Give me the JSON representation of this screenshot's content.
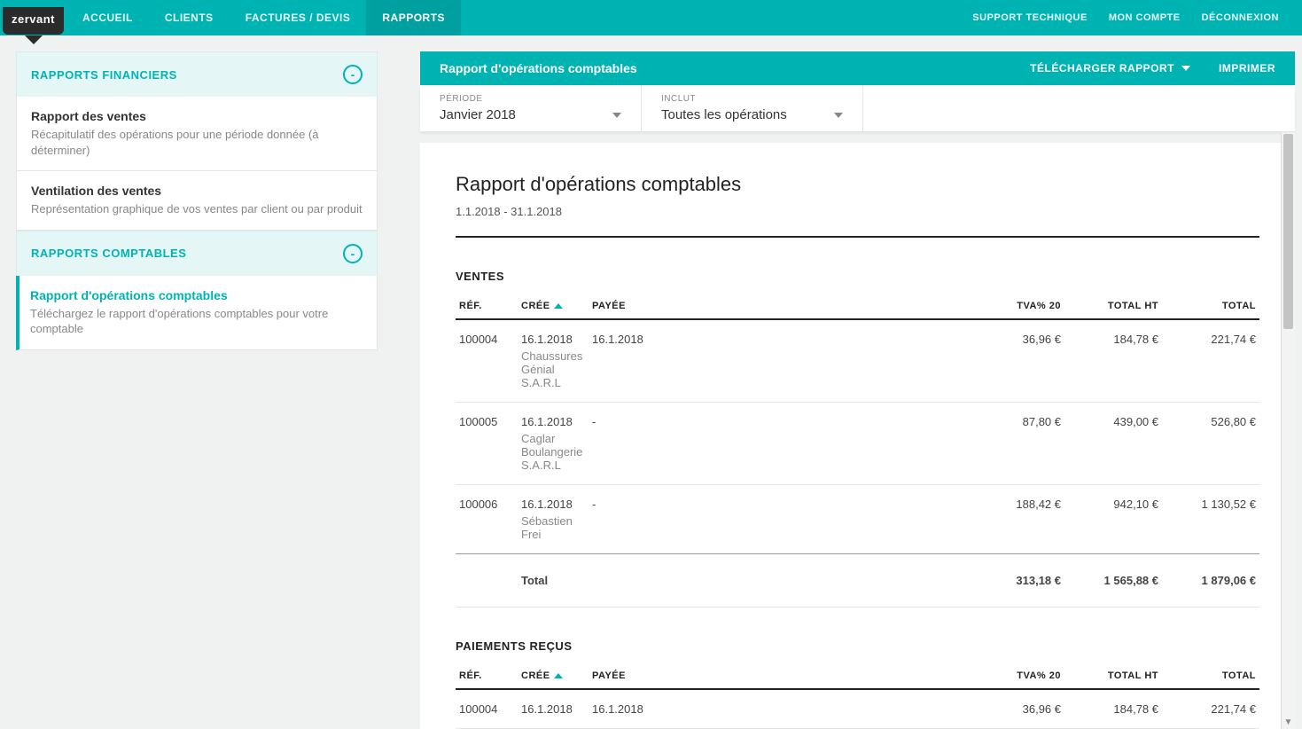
{
  "brand": "zervant",
  "nav": {
    "left": [
      "ACCUEIL",
      "CLIENTS",
      "FACTURES / DEVIS",
      "RAPPORTS"
    ],
    "active_index": 3,
    "right": [
      "SUPPORT TECHNIQUE",
      "MON COMPTE",
      "DÉCONNEXION"
    ]
  },
  "sidebar": {
    "group1": {
      "title": "RAPPORTS FINANCIERS",
      "items": [
        {
          "title": "Rapport des ventes",
          "desc": "Récapitulatif des opérations pour une période donnée (à déterminer)"
        },
        {
          "title": "Ventilation des ventes",
          "desc": "Représentation graphique de vos ventes par client ou par produit"
        }
      ]
    },
    "group2": {
      "title": "RAPPORTS COMPTABLES",
      "items": [
        {
          "title": "Rapport d'opérations comptables",
          "desc": "Téléchargez le rapport d'opérations comptables pour votre comptable"
        }
      ]
    }
  },
  "header": {
    "title": "Rapport d'opérations comptables",
    "download": "TÉLÉCHARGER RAPPORT",
    "print": "IMPRIMER"
  },
  "filters": {
    "period_label": "PÉRIODE",
    "period_value": "Janvier 2018",
    "includes_label": "INCLUT",
    "includes_value": "Toutes les opérations"
  },
  "report": {
    "title": "Rapport d'opérations comptables",
    "date_range": "1.1.2018 - 31.1.2018",
    "sections": {
      "sales": {
        "title": "VENTES",
        "cols": {
          "ref": "RÉF.",
          "created": "CRÉE",
          "paid": "PAYÉE",
          "vat": "TVA% 20",
          "total_ht": "TOTAL HT",
          "total": "TOTAL"
        },
        "rows": [
          {
            "ref": "100004",
            "created": "16.1.2018",
            "paid": "16.1.2018",
            "client": "Chaussures Génial S.A.R.L",
            "vat": "36,96 €",
            "total_ht": "184,78 €",
            "total": "221,74 €"
          },
          {
            "ref": "100005",
            "created": "16.1.2018",
            "paid": "-",
            "client": "Caglar Boulangerie S.A.R.L",
            "vat": "87,80 €",
            "total_ht": "439,00 €",
            "total": "526,80 €"
          },
          {
            "ref": "100006",
            "created": "16.1.2018",
            "paid": "-",
            "client": "Sébastien Frei",
            "vat": "188,42 €",
            "total_ht": "942,10 €",
            "total": "1 130,52 €"
          }
        ],
        "total_label": "Total",
        "totals": {
          "vat": "313,18 €",
          "total_ht": "1 565,88 €",
          "total": "1 879,06 €"
        }
      },
      "payments": {
        "title": "PAIEMENTS REÇUS",
        "cols": {
          "ref": "RÉF.",
          "created": "CRÉE",
          "paid": "PAYÉE",
          "vat": "TVA% 20",
          "total_ht": "TOTAL HT",
          "total": "TOTAL"
        },
        "rows": [
          {
            "ref": "100004",
            "created": "16.1.2018",
            "paid": "16.1.2018",
            "client": "",
            "vat": "36,96 €",
            "total_ht": "184,78 €",
            "total": "221,74 €"
          }
        ]
      }
    }
  }
}
